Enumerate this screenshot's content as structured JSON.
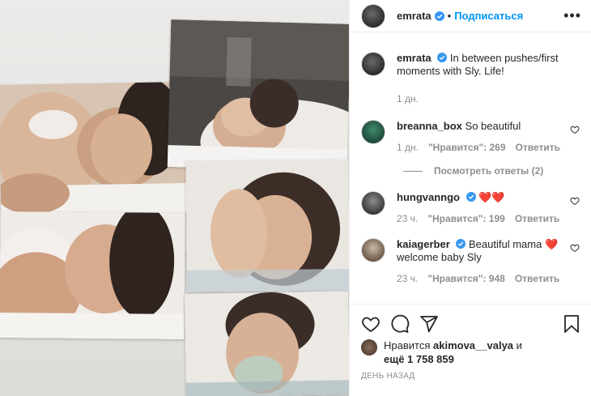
{
  "header": {
    "username": "emrata",
    "separator": "•",
    "follow_label": "Подписаться",
    "more_label": "•••"
  },
  "caption": {
    "username": "emrata",
    "text": "In between pushes/first moments with Sly. Life!",
    "time": "1 дн."
  },
  "comments": [
    {
      "username": "breanna_box",
      "verified": false,
      "text": "So beautiful",
      "time": "1 дн.",
      "likes": "\"Нравится\": 269",
      "reply_label": "Ответить",
      "view_replies": "Посмотреть ответы (2)"
    },
    {
      "username": "hungvanngo",
      "verified": true,
      "text": "❤️❤️",
      "time": "23 ч.",
      "likes": "\"Нравится\": 199",
      "reply_label": "Ответить"
    },
    {
      "username": "kaiagerber",
      "verified": true,
      "text": "Beautiful mama ❤️ welcome baby Sly",
      "time": "23 ч.",
      "likes": "\"Нравится\": 948",
      "reply_label": "Ответить"
    }
  ],
  "likes_summary": {
    "prefix": "Нравится",
    "user": "akimova__valya",
    "conj": "и",
    "count": "ещё 1 758 859"
  },
  "posted": "ДЕНЬ НАЗАД",
  "icons": {
    "like": "heart-icon",
    "comment": "comment-icon",
    "share": "paper-plane-icon",
    "save": "bookmark-icon",
    "verified": "verified-badge-icon"
  },
  "colors": {
    "accent": "#0095f6",
    "verified": "#3897f0",
    "muted": "#8e8e8e",
    "heart_red": "#ed4956"
  }
}
